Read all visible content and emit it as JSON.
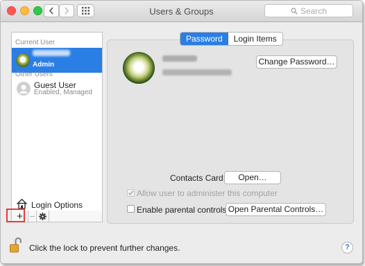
{
  "window": {
    "title": "Users & Groups"
  },
  "toolbar": {
    "back_icon": "chevron-left-icon",
    "forward_icon": "chevron-right-icon",
    "grid_icon": "grid-icon",
    "search_placeholder": "Search"
  },
  "sidebar": {
    "current_user_header": "Current User",
    "current_user": {
      "role": "Admin"
    },
    "other_users_header": "Other Users",
    "other_users": [
      {
        "name": "Guest User",
        "subtitle": "Enabled, Managed"
      }
    ],
    "login_options_label": "Login Options",
    "add_button_label": "+",
    "remove_button_label": "−",
    "gear_icon": "gear-icon"
  },
  "tabs": [
    {
      "label": "Password",
      "active": true
    },
    {
      "label": "Login Items",
      "active": false
    }
  ],
  "detail": {
    "change_password_label": "Change Password…",
    "contacts_card_label": "Contacts Card:",
    "open_label": "Open…",
    "allow_admin_label": "Allow user to administer this computer",
    "allow_admin_checked": true,
    "parental_controls_label": "Enable parental controls",
    "parental_controls_checked": false,
    "open_parental_controls_label": "Open Parental Controls…"
  },
  "footer": {
    "lock_text": "Click the lock to prevent further changes.",
    "help_label": "?"
  },
  "colors": {
    "accent": "#2a7ee4",
    "highlight": "#e23b3b"
  }
}
